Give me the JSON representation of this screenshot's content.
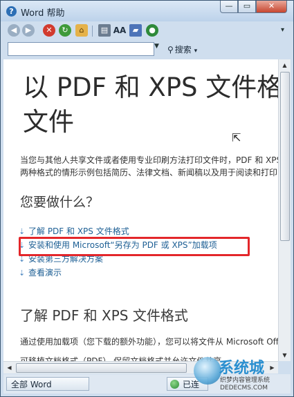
{
  "window": {
    "title": "Word 帮助",
    "app_icon": "?",
    "controls": {
      "minimize": "—",
      "maximize": "▭",
      "close": "✕"
    }
  },
  "toolbar": {
    "icons": [
      "back-icon",
      "forward-icon",
      "stop-icon",
      "refresh-icon",
      "home-icon",
      "print-icon",
      "font-size-icon",
      "book-icon",
      "pin-icon"
    ],
    "font_label": "AA"
  },
  "search": {
    "value": "",
    "button_label": "搜索"
  },
  "article": {
    "title": "以 PDF 和 XPS 文件格式保存文件",
    "intro": "当您与其他人共享文件或者使用专业印刷方法打印文件时，PDF 和 XPS 格式十分有用。适用于这两种格式的情形示例包括简历、法律文档、新闻稿以及用于阅读和打印的文件。",
    "section1_heading": "您要做什么？",
    "links": [
      "了解 PDF 和 XPS 文件格式",
      "安装和使用 Microsoft“另存为 PDF 或 XPS”加载项",
      "安装第三方解决方案",
      "查看演示"
    ],
    "section2_heading": "了解 PDF 和 XPS 文件格式",
    "para2": "通过使用加载项（您下载的额外功能），您可以将文件从 Microsoft Office",
    "bullet": "可移植文档格式（PDF）  保留文档格式并允许文件共享"
  },
  "status": {
    "scope_label": "全部 Word",
    "connection_label": "已连"
  },
  "watermark": {
    "brand": "系统城",
    "line1": "织梦内容管理系统",
    "line2": "DEDECMS.COM"
  }
}
